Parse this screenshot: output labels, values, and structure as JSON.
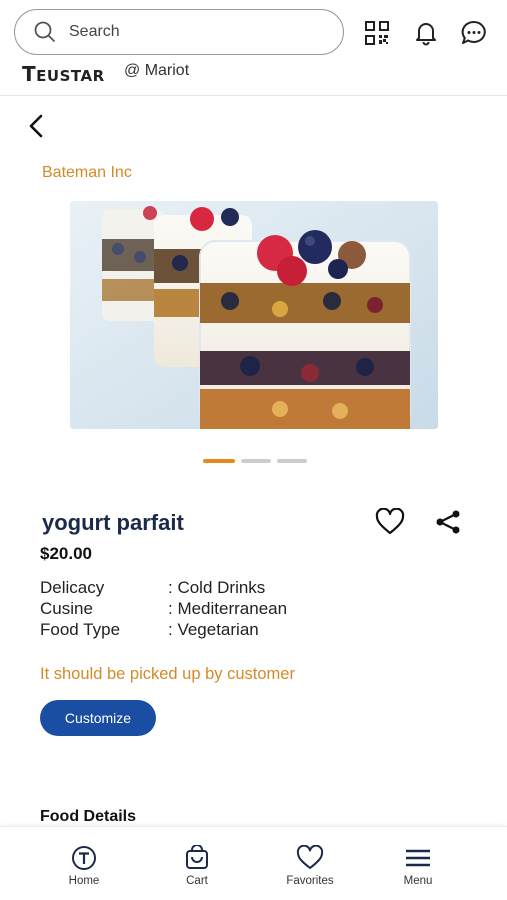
{
  "header": {
    "search_placeholder": "Search",
    "brand": "TEUSTAR",
    "brand_first": "T",
    "brand_rest": "EUSTAR",
    "handle": "@ Mariot",
    "icons": [
      "search-icon",
      "qr-code-icon",
      "bell-icon",
      "chat-icon"
    ]
  },
  "product": {
    "vendor": "Bateman Inc",
    "name": "yogurt parfait",
    "price": "$20.00",
    "carousel": {
      "count": 3,
      "active_index": 0
    },
    "attributes": [
      {
        "key": "Delicacy",
        "value": ": Cold Drinks"
      },
      {
        "key": "Cusine",
        "value": ": Mediterranean"
      },
      {
        "key": "Food Type",
        "value": ": Vegetarian"
      }
    ],
    "pickup_note": "It should be picked up by customer",
    "customize_label": "Customize",
    "details_heading": "Food Details"
  },
  "nav": {
    "items": [
      {
        "label": "Home",
        "icon": "home-t-icon"
      },
      {
        "label": "Cart",
        "icon": "cart-icon"
      },
      {
        "label": "Favorites",
        "icon": "heart-icon"
      },
      {
        "label": "Menu",
        "icon": "menu-icon"
      }
    ]
  },
  "colors": {
    "accent_orange": "#d48a27",
    "primary_blue": "#1a4ea3",
    "title_navy": "#1c2a4a"
  }
}
